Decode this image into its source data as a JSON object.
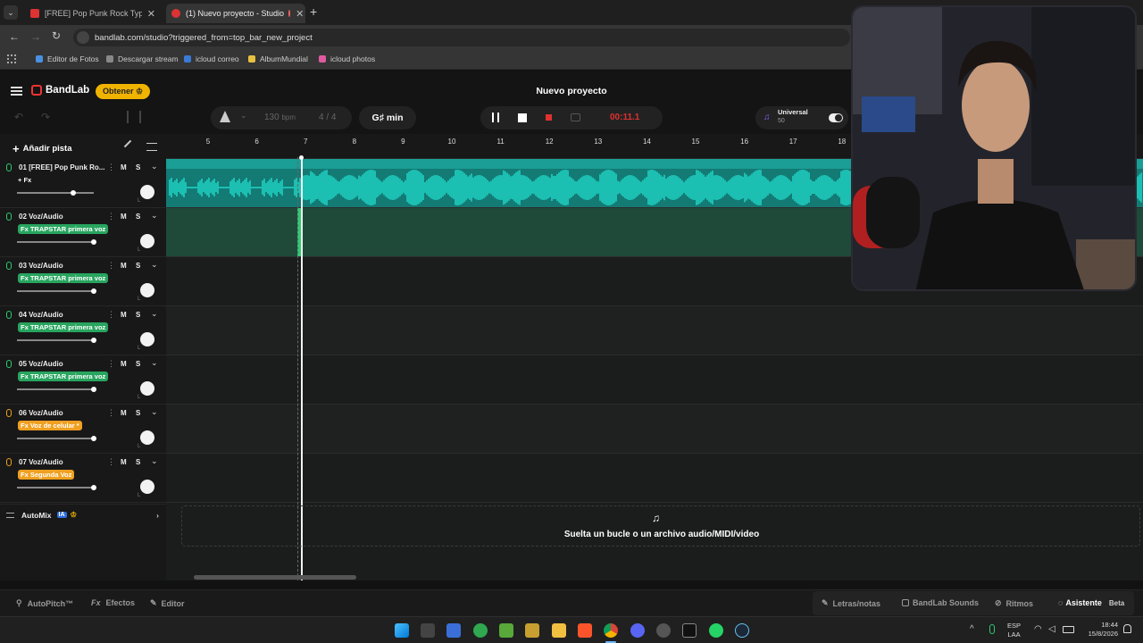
{
  "browser": {
    "tabs": [
      {
        "label": "[FREE] Pop Punk Rock Type Be",
        "active": false
      },
      {
        "label": "(1) Nuevo proyecto - Studio",
        "active": true
      }
    ],
    "new_tab": "+",
    "url": "bandlab.com/studio?triggered_from=top_bar_new_project",
    "bookmarks": [
      "Editor de Fotos",
      "Descargar stream",
      "icloud correo",
      "AlbumMundial",
      "icloud photos"
    ]
  },
  "app": {
    "brand": "BandLab",
    "get_button": "Obtener",
    "project_title": "Nuevo proyecto",
    "tempo": "130",
    "tempo_unit": "bpm",
    "time_signature_num": "4",
    "time_signature_sep": "/",
    "time_signature_den": "4",
    "key": "G♯ min",
    "time_display": "00:11.1",
    "preset_name": "Universal",
    "preset_value": "50",
    "add_track": "Añadir pista",
    "drop_zone_text": "Suelta un bucle o un archivo audio/MIDI/video",
    "automix": "AutoMix",
    "automix_badge": "IA"
  },
  "ruler": [
    "5",
    "6",
    "7",
    "8",
    "9",
    "10",
    "11",
    "12",
    "13",
    "14",
    "15",
    "16",
    "17",
    "18"
  ],
  "tracks": [
    {
      "num": "01",
      "name": "[FREE] Pop Punk Ro...",
      "fx": "+ Fx",
      "fx_style": "plain",
      "mic_color": "#2ecc71",
      "volume": 0.72
    },
    {
      "num": "02",
      "name": "Voz/Audio",
      "fx": "Fx TRAPSTAR primera voz",
      "fx_style": "green",
      "mic_color": "#2ecc71",
      "volume": 1.0
    },
    {
      "num": "03",
      "name": "Voz/Audio",
      "fx": "Fx TRAPSTAR primera voz",
      "fx_style": "green",
      "mic_color": "#2ecc71",
      "volume": 1.0
    },
    {
      "num": "04",
      "name": "Voz/Audio",
      "fx": "Fx TRAPSTAR primera voz",
      "fx_style": "green",
      "mic_color": "#2ecc71",
      "volume": 1.0
    },
    {
      "num": "05",
      "name": "Voz/Audio",
      "fx": "Fx TRAPSTAR primera voz",
      "fx_style": "green",
      "mic_color": "#2ecc71",
      "volume": 1.0
    },
    {
      "num": "06",
      "name": "Voz/Audio",
      "fx": "Fx Voz de celular *",
      "fx_style": "orange",
      "mic_color": "#f0a020",
      "volume": 1.0
    },
    {
      "num": "07",
      "name": "Voz/Audio",
      "fx": "Fx Segunda Voz",
      "fx_style": "orange",
      "mic_color": "#f0a020",
      "volume": 1.0
    }
  ],
  "track_controls": {
    "mute": "M",
    "solo": "S"
  },
  "bottom_bar": {
    "autopitch": "AutoPitch™",
    "effects_prefix": "Fx",
    "effects": "Efectos",
    "editor": "Editor",
    "lyrics": "Letras/notas",
    "sounds": "BandLab Sounds",
    "rhythms": "Ritmos",
    "assistant": "Asistente",
    "beta": "Beta"
  },
  "system": {
    "lang": "ESP",
    "lang_sub": "LAA",
    "time": "18:44",
    "date": "15/8/2026"
  },
  "colors": {
    "accent": "#f0b400",
    "waveform": "#1fd1c1",
    "track_green": "#2ecc71",
    "record": "#e0312f",
    "time": "#e0312f"
  }
}
